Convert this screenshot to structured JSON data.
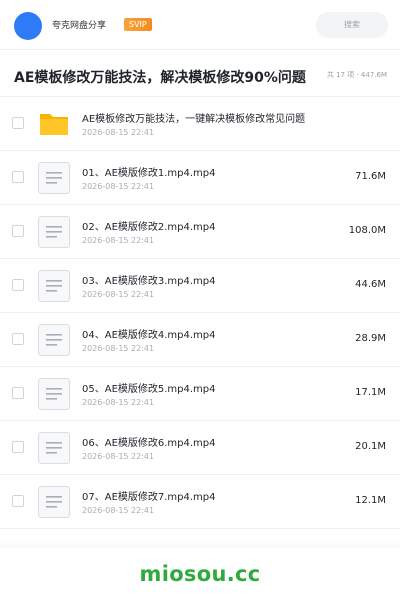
{
  "header": {
    "brand": "夸克网盘分享",
    "vip_badge": "SVIP",
    "search_placeholder": "搜索"
  },
  "share": {
    "title": "AE模板修改万能技法，解决模板修改90%问题",
    "summary": "共 17 项 · 447.6M"
  },
  "icons": {
    "folder": "folder-icon",
    "file": "document-icon"
  },
  "colors": {
    "avatar": "#2f7bf7",
    "vip": "#f58a22",
    "folder": "#ffc629",
    "logo": "#2faa3f"
  },
  "files": [
    {
      "name": "AE模板修改万能技法，一键解决模板修改常见问题",
      "date": "2026-08-15 22:41",
      "size": "",
      "type": "folder"
    },
    {
      "name": "01、AE模版修改1.mp4.mp4",
      "date": "2026-08-15 22:41",
      "size": "71.6M",
      "type": "file"
    },
    {
      "name": "02、AE模版修改2.mp4.mp4",
      "date": "2026-08-15 22:41",
      "size": "108.0M",
      "type": "file"
    },
    {
      "name": "03、AE模版修改3.mp4.mp4",
      "date": "2026-08-15 22:41",
      "size": "44.6M",
      "type": "file"
    },
    {
      "name": "04、AE模版修改4.mp4.mp4",
      "date": "2026-08-15 22:41",
      "size": "28.9M",
      "type": "file"
    },
    {
      "name": "05、AE模版修改5.mp4.mp4",
      "date": "2026-08-15 22:41",
      "size": "17.1M",
      "type": "file"
    },
    {
      "name": "06、AE模版修改6.mp4.mp4",
      "date": "2026-08-15 22:41",
      "size": "20.1M",
      "type": "file"
    },
    {
      "name": "07、AE模版修改7.mp4.mp4",
      "date": "2026-08-15 22:41",
      "size": "12.1M",
      "type": "file"
    }
  ],
  "footer": {
    "logo": "miosou.cc"
  }
}
